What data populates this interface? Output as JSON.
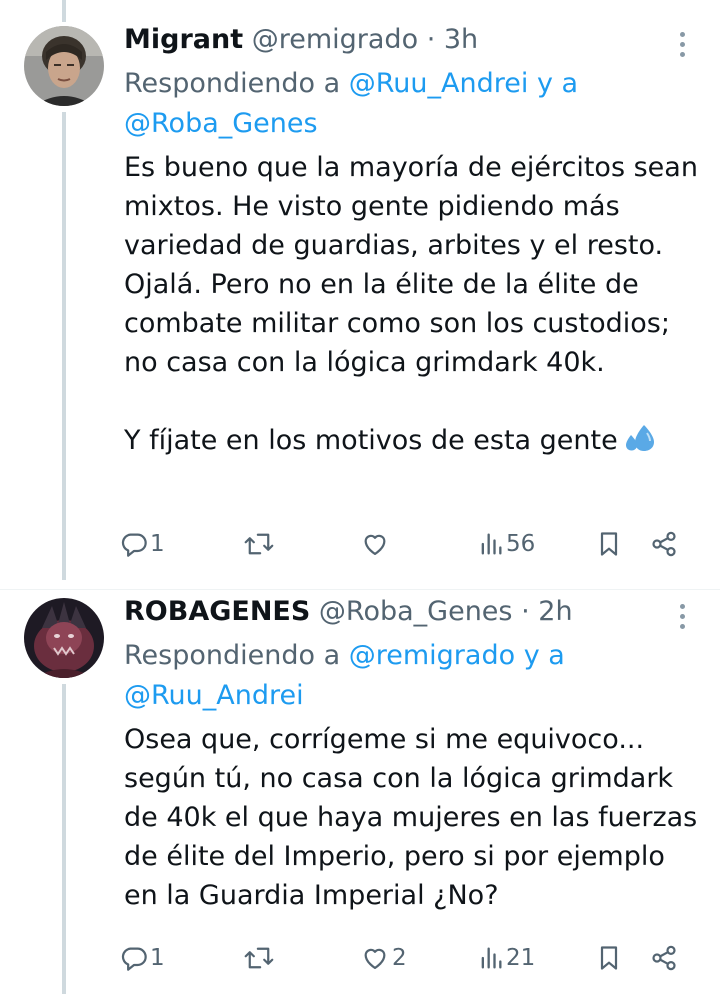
{
  "tweets": [
    {
      "name": "Migrant",
      "handle": "@remigrado",
      "separator": "·",
      "time": "3h",
      "reply_prefix": "Respondiendo a",
      "reply_mention_1": "@Ruu_Andrei",
      "reply_conj": "y a",
      "reply_mention_2": "@Roba_Genes",
      "text": "Es bueno que la mayoría de ejércitos sean mixtos. He visto gente pidiendo más variedad de guardias, arbites y el resto. Ojalá. Pero no en la élite de la élite de combate militar como son los custodios; no casa con la lógica grimdark 40k.\n\nY fíjate en los motivos de esta gente",
      "emoji": "sweat-droplets-emoji",
      "stats": {
        "replies": "1",
        "retweets": "",
        "likes": "",
        "views": "56"
      }
    },
    {
      "name": "ROBAGENES",
      "handle": "@Roba_Genes",
      "separator": "·",
      "time": "2h",
      "reply_prefix": "Respondiendo a",
      "reply_mention_1": "@remigrado",
      "reply_conj": "y a",
      "reply_mention_2": "@Ruu_Andrei",
      "text": "Osea que, corrígeme si me equivoco... según tú, no casa con la lógica grimdark de 40k el que haya mujeres en las fuerzas de élite del Imperio, pero si por ejemplo en la Guardia Imperial ¿No?",
      "stats": {
        "replies": "1",
        "retweets": "",
        "likes": "2",
        "views": "21"
      }
    }
  ],
  "icons": [
    "more-icon",
    "reply-icon",
    "retweet-icon",
    "like-icon",
    "views-icon",
    "bookmark-icon",
    "share-icon"
  ],
  "colors": {
    "text": "#0f1419",
    "secondary": "#536471",
    "link": "#1d9bf0",
    "thread_line": "#cfd9de",
    "emoji_blue": "#5aa9e6"
  }
}
